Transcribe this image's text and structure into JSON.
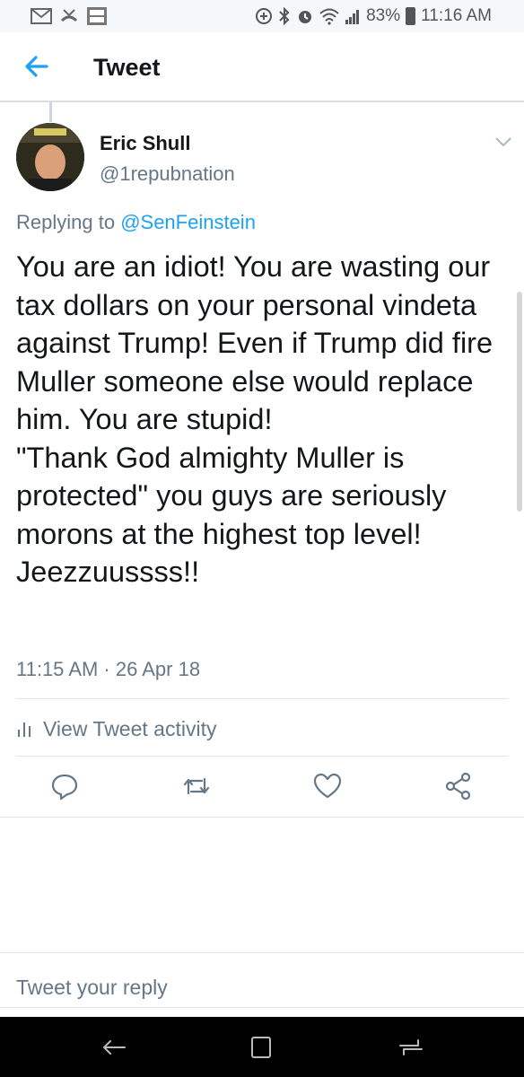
{
  "status_bar": {
    "battery": "83%",
    "time": "11:16 AM",
    "left_icons": [
      "mail-icon",
      "missed-call-icon",
      "fox-news-icon"
    ],
    "right_icons": [
      "data-saver-icon",
      "bluetooth-icon",
      "alarm-icon",
      "wifi-icon",
      "signal-icon",
      "battery-icon"
    ]
  },
  "header": {
    "title": "Tweet"
  },
  "tweet": {
    "author_name": "Eric Shull",
    "author_handle": "@1repubnation",
    "replying_prefix": "Replying to ",
    "replying_to": "@SenFeinstein",
    "text": "You are an idiot! You are wasting our tax dollars on your personal vindeta against Trump! Even if Trump did fire Muller someone else would replace him. You are stupid!\n\"Thank God almighty Muller is protected\" you guys are seriously morons at the highest top level! Jeezzuussss!!",
    "timestamp": "11:15 AM · 26 Apr 18"
  },
  "activity": {
    "label": "View Tweet activity"
  },
  "actions": [
    "reply-icon",
    "retweet-icon",
    "like-icon",
    "share-icon"
  ],
  "reply_box": {
    "placeholder": "Tweet your reply"
  },
  "colors": {
    "accent": "#1da1f2",
    "secondary_text": "#657786",
    "primary_text": "#14171a",
    "divider": "#e1e8ed"
  }
}
